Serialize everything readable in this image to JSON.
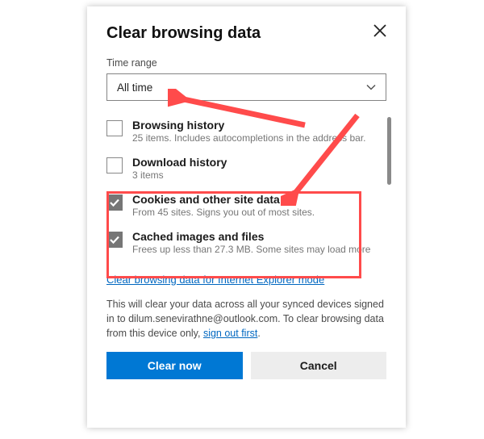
{
  "dialog": {
    "title": "Clear browsing data",
    "time_range_label": "Time range",
    "time_range_value": "All time"
  },
  "options": [
    {
      "label": "Browsing history",
      "desc": "25 items. Includes autocompletions in the address bar.",
      "checked": false
    },
    {
      "label": "Download history",
      "desc": "3 items",
      "checked": false
    },
    {
      "label": "Cookies and other site data",
      "desc": "From 45 sites. Signs you out of most sites.",
      "checked": true
    },
    {
      "label": "Cached images and files",
      "desc": "Frees up less than 27.3 MB. Some sites may load more",
      "checked": true
    }
  ],
  "ie_link": "Clear browsing data for Internet Explorer mode",
  "info": {
    "pre": "This will clear your data across all your synced devices signed in to ",
    "email": "dilum.senevirathne@outlook.com",
    "mid": ". To clear browsing data from this device only, ",
    "link": "sign out first",
    "post": "."
  },
  "buttons": {
    "primary": "Clear now",
    "secondary": "Cancel"
  },
  "annotation": {
    "arrow_color": "#ff4b4b"
  }
}
